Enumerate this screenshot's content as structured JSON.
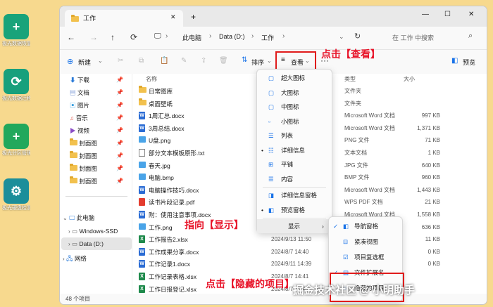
{
  "desktop_icons": [
    {
      "label": "极光数据恢复大师",
      "color": "#19a37a",
      "glyph": "+"
    },
    {
      "label": "极光数据迁移工具",
      "color": "#17a07c",
      "glyph": "⟳"
    },
    {
      "label": "极光分区管理工具",
      "color": "#22a85c",
      "glyph": "+"
    },
    {
      "label": "极光硬盘检测修复工具",
      "color": "#1b8e9a",
      "glyph": "⚙"
    }
  ],
  "window": {
    "tab_title": "工作",
    "new_tab": "+",
    "controls": {
      "minimize": "—",
      "maximize": "☐",
      "close": "✕"
    }
  },
  "nav": {
    "breadcrumb": [
      "此电脑",
      "Data (D:)",
      "工作"
    ],
    "search_placeholder": "在 工作 中搜索"
  },
  "toolbar": {
    "new_label": "新建",
    "sort_label": "排序",
    "view_label": "查看",
    "more": "···",
    "preview_label": "预览"
  },
  "annotations": {
    "click_view": "点击【查看】",
    "point_show": "指向【显示】",
    "click_hidden": "点击【隐藏的项目】",
    "watermark": "掘金技术社区 @ 小明助手"
  },
  "sidebar": {
    "quick": [
      {
        "label": "下载",
        "icon": "download-icon",
        "color": "#2b7bd8"
      },
      {
        "label": "文档",
        "icon": "document-icon",
        "color": "#4f77c9"
      },
      {
        "label": "图片",
        "icon": "pictures-icon",
        "color": "#3aa0e0"
      },
      {
        "label": "音乐",
        "icon": "music-icon",
        "color": "#e5594a"
      },
      {
        "label": "视频",
        "icon": "video-icon",
        "color": "#8a4cc6"
      },
      {
        "label": "封面图",
        "icon": "folder-icon",
        "color": "#f2c14e"
      },
      {
        "label": "封面图",
        "icon": "folder-icon",
        "color": "#f2c14e"
      },
      {
        "label": "封面图",
        "icon": "folder-icon",
        "color": "#f2c14e"
      },
      {
        "label": "封面图",
        "icon": "folder-icon",
        "color": "#f2c14e"
      }
    ],
    "tree": [
      {
        "label": "此电脑",
        "icon": "computer-icon"
      },
      {
        "label": "Windows-SSD",
        "icon": "drive-icon"
      },
      {
        "label": "Data (D:)",
        "icon": "drive-icon"
      },
      {
        "label": "网络",
        "icon": "network-icon"
      }
    ]
  },
  "columns": {
    "name": "名称",
    "type": "类型",
    "size": "大小"
  },
  "files": [
    {
      "name": "日常图库",
      "icon": "folder",
      "date": "",
      "type": "文件夹",
      "size": ""
    },
    {
      "name": "桌面壁纸",
      "icon": "folder",
      "date": "",
      "type": "文件夹",
      "size": ""
    },
    {
      "name": "1周汇总.docx",
      "icon": "word",
      "date": "",
      "type": "Microsoft Word 文档",
      "size": "997 KB"
    },
    {
      "name": "3周总结.docx",
      "icon": "word",
      "date": "",
      "type": "Microsoft Word 文档",
      "size": "1,371 KB"
    },
    {
      "name": "U盘.png",
      "icon": "image",
      "date": "",
      "type": "PNG 文件",
      "size": "71 KB"
    },
    {
      "name": "部分文本模板原形.txt",
      "icon": "text",
      "date": "",
      "type": "文本文档",
      "size": "1 KB"
    },
    {
      "name": "春天.jpg",
      "icon": "image",
      "date": "",
      "type": "JPG 文件",
      "size": "640 KB"
    },
    {
      "name": "电脑.bmp",
      "icon": "image",
      "date": "",
      "type": "BMP 文件",
      "size": "960 KB"
    },
    {
      "name": "电脑操作技巧.docx",
      "icon": "word",
      "date": "",
      "type": "Microsoft Word 文档",
      "size": "1,443 KB"
    },
    {
      "name": "读书片段记录.pdf",
      "icon": "pdf",
      "date": "",
      "type": "WPS PDF 文档",
      "size": "21 KB"
    },
    {
      "name": "附：使用注意事项.docx",
      "icon": "word",
      "date": "",
      "type": "Microsoft Word 文档",
      "size": "1,558 KB"
    },
    {
      "name": "工作.png",
      "icon": "image",
      "date": "",
      "type": "",
      "size": "636 KB"
    },
    {
      "name": "工作报告2.xlsx",
      "icon": "excel",
      "date": "2024/9/13 11:50",
      "type": "",
      "size": "11 KB"
    },
    {
      "name": "工作成果分享.docx",
      "icon": "word",
      "date": "2024/8/7 14:40",
      "type": "",
      "size": "0 KB"
    },
    {
      "name": "工作记录1.docx",
      "icon": "word",
      "date": "2024/9/11 14:39",
      "type": "",
      "size": "0 KB"
    },
    {
      "name": "工作记录表格.xlsx",
      "icon": "excel",
      "date": "2024/8/7 14:41",
      "type": "",
      "size": ""
    },
    {
      "name": "工作日报登记.xlsx",
      "icon": "excel",
      "date": "2024/8/7 14:41",
      "type": "",
      "size": ""
    }
  ],
  "status": {
    "count": "48 个项目"
  },
  "view_menu": [
    {
      "label": "超大图标",
      "icon": "extra-large-icons-icon",
      "checked": false
    },
    {
      "label": "大图标",
      "icon": "large-icons-icon",
      "checked": false
    },
    {
      "label": "中图标",
      "icon": "medium-icons-icon",
      "checked": false
    },
    {
      "label": "小图标",
      "icon": "small-icons-icon",
      "checked": false
    },
    {
      "label": "列表",
      "icon": "list-icon",
      "checked": false
    },
    {
      "label": "详细信息",
      "icon": "details-icon",
      "checked": true
    },
    {
      "label": "平铺",
      "icon": "tiles-icon",
      "checked": false
    },
    {
      "label": "内容",
      "icon": "content-icon",
      "checked": false
    },
    {
      "label": "详细信息窗格",
      "icon": "details-pane-icon",
      "checked": false
    },
    {
      "label": "预览窗格",
      "icon": "preview-pane-icon",
      "checked": true
    },
    {
      "label": "显示",
      "icon": "",
      "checked": false,
      "submenu": true
    }
  ],
  "show_submenu": [
    {
      "label": "导航窗格",
      "icon": "navigation-pane-icon",
      "checked": true
    },
    {
      "label": "紧凑视图",
      "icon": "compact-view-icon",
      "checked": false
    },
    {
      "label": "项目复选框",
      "icon": "checkbox-icon",
      "checked": false
    },
    {
      "label": "文件扩展名",
      "icon": "extension-icon",
      "checked": true
    },
    {
      "label": "隐藏的项目",
      "icon": "hidden-items-icon",
      "checked": false
    }
  ]
}
